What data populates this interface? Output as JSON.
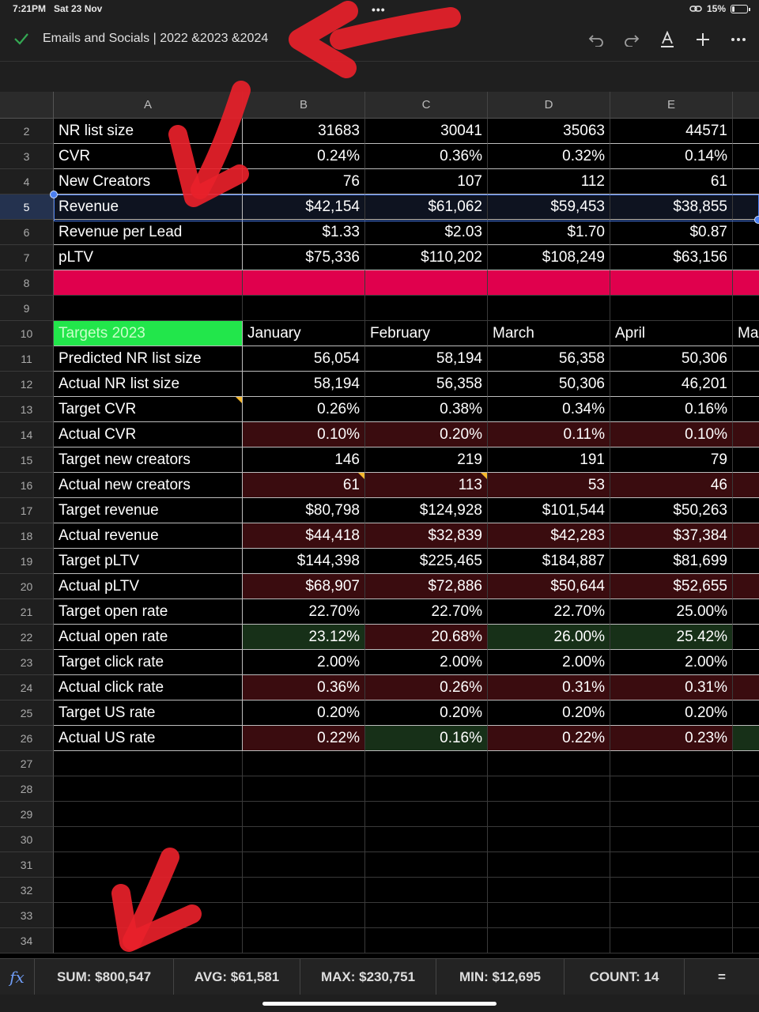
{
  "status_bar": {
    "time": "7:21PM",
    "date": "Sat 23 Nov",
    "battery": "15%",
    "battery_level": 0.15
  },
  "toolbar": {
    "title": "Emails and Socials | 2022 &2023 &2024"
  },
  "columns": [
    "A",
    "B",
    "C",
    "D",
    "E"
  ],
  "rows": [
    {
      "n": "2",
      "cells": [
        "NR list size",
        "31683",
        "30041",
        "35063",
        "44571"
      ]
    },
    {
      "n": "3",
      "cells": [
        "CVR",
        "0.24%",
        "0.36%",
        "0.32%",
        "0.14%"
      ]
    },
    {
      "n": "4",
      "cells": [
        "New Creators",
        "76",
        "107",
        "112",
        "61"
      ]
    },
    {
      "n": "5",
      "cells": [
        "Revenue",
        "$42,154",
        "$61,062",
        "$59,453",
        "$38,855"
      ]
    },
    {
      "n": "6",
      "cells": [
        "Revenue per Lead",
        "$1.33",
        "$2.03",
        "$1.70",
        "$0.87"
      ]
    },
    {
      "n": "7",
      "cells": [
        "pLTV",
        "$75,336",
        "$110,202",
        "$108,249",
        "$63,156"
      ]
    },
    {
      "n": "8",
      "cells": [
        "",
        "",
        "",
        "",
        ""
      ]
    },
    {
      "n": "9",
      "cells": [
        "",
        "",
        "",
        "",
        ""
      ]
    },
    {
      "n": "10",
      "cells": [
        "Targets 2023",
        "January",
        "February",
        "March",
        "April"
      ],
      "extra": "Ma"
    },
    {
      "n": "11",
      "cells": [
        "Predicted NR list size",
        "56,054",
        "58,194",
        "56,358",
        "50,306"
      ]
    },
    {
      "n": "12",
      "cells": [
        "Actual NR list size",
        "58,194",
        "56,358",
        "50,306",
        "46,201"
      ]
    },
    {
      "n": "13",
      "cells": [
        "Target CVR",
        "0.26%",
        "0.38%",
        "0.34%",
        "0.16%"
      ]
    },
    {
      "n": "14",
      "cells": [
        "Actual CVR",
        "0.10%",
        "0.20%",
        "0.11%",
        "0.10%"
      ]
    },
    {
      "n": "15",
      "cells": [
        "Target new creators",
        "146",
        "219",
        "191",
        "79"
      ]
    },
    {
      "n": "16",
      "cells": [
        "Actual new creators",
        "61",
        "113",
        "53",
        "46"
      ]
    },
    {
      "n": "17",
      "cells": [
        "Target revenue",
        "$80,798",
        "$124,928",
        "$101,544",
        "$50,263"
      ]
    },
    {
      "n": "18",
      "cells": [
        "Actual revenue",
        "$44,418",
        "$32,839",
        "$42,283",
        "$37,384"
      ]
    },
    {
      "n": "19",
      "cells": [
        "Target pLTV",
        "$144,398",
        "$225,465",
        "$184,887",
        "$81,699"
      ]
    },
    {
      "n": "20",
      "cells": [
        "Actual pLTV",
        "$68,907",
        "$72,886",
        "$50,644",
        "$52,655"
      ]
    },
    {
      "n": "21",
      "cells": [
        "Target open rate",
        "22.70%",
        "22.70%",
        "22.70%",
        "25.00%"
      ]
    },
    {
      "n": "22",
      "cells": [
        "Actual open rate",
        "23.12%",
        "20.68%",
        "26.00%",
        "25.42%"
      ]
    },
    {
      "n": "23",
      "cells": [
        "Target click rate",
        "2.00%",
        "2.00%",
        "2.00%",
        "2.00%"
      ]
    },
    {
      "n": "24",
      "cells": [
        "Actual click rate",
        "0.36%",
        "0.26%",
        "0.31%",
        "0.31%"
      ]
    },
    {
      "n": "25",
      "cells": [
        "Target US rate",
        "0.20%",
        "0.20%",
        "0.20%",
        "0.20%"
      ]
    },
    {
      "n": "26",
      "cells": [
        "Actual US rate",
        "0.22%",
        "0.16%",
        "0.22%",
        "0.23%"
      ]
    },
    {
      "n": "27",
      "cells": [
        "",
        "",
        "",
        "",
        ""
      ]
    },
    {
      "n": "28",
      "cells": [
        "",
        "",
        "",
        "",
        ""
      ]
    },
    {
      "n": "29",
      "cells": [
        "",
        "",
        "",
        "",
        ""
      ]
    },
    {
      "n": "30",
      "cells": [
        "",
        "",
        "",
        "",
        ""
      ]
    },
    {
      "n": "31",
      "cells": [
        "",
        "",
        "",
        "",
        ""
      ]
    },
    {
      "n": "32",
      "cells": [
        "",
        "",
        "",
        "",
        ""
      ]
    },
    {
      "n": "33",
      "cells": [
        "",
        "",
        "",
        "",
        ""
      ]
    },
    {
      "n": "34",
      "cells": [
        "",
        "",
        "",
        "",
        ""
      ]
    }
  ],
  "footer": {
    "sum": "SUM: $800,547",
    "avg": "AVG: $61,581",
    "max": "MAX: $230,751",
    "min": "MIN: $12,695",
    "count": "COUNT: 14",
    "equals": "="
  },
  "colors": {
    "red_fill": "#3a0c0f",
    "green_fill": "#173018",
    "pink_band": "#e0004d",
    "lime_header": "#22e64b",
    "selection": "#4a7ef0",
    "annotation": "#e8212a"
  }
}
